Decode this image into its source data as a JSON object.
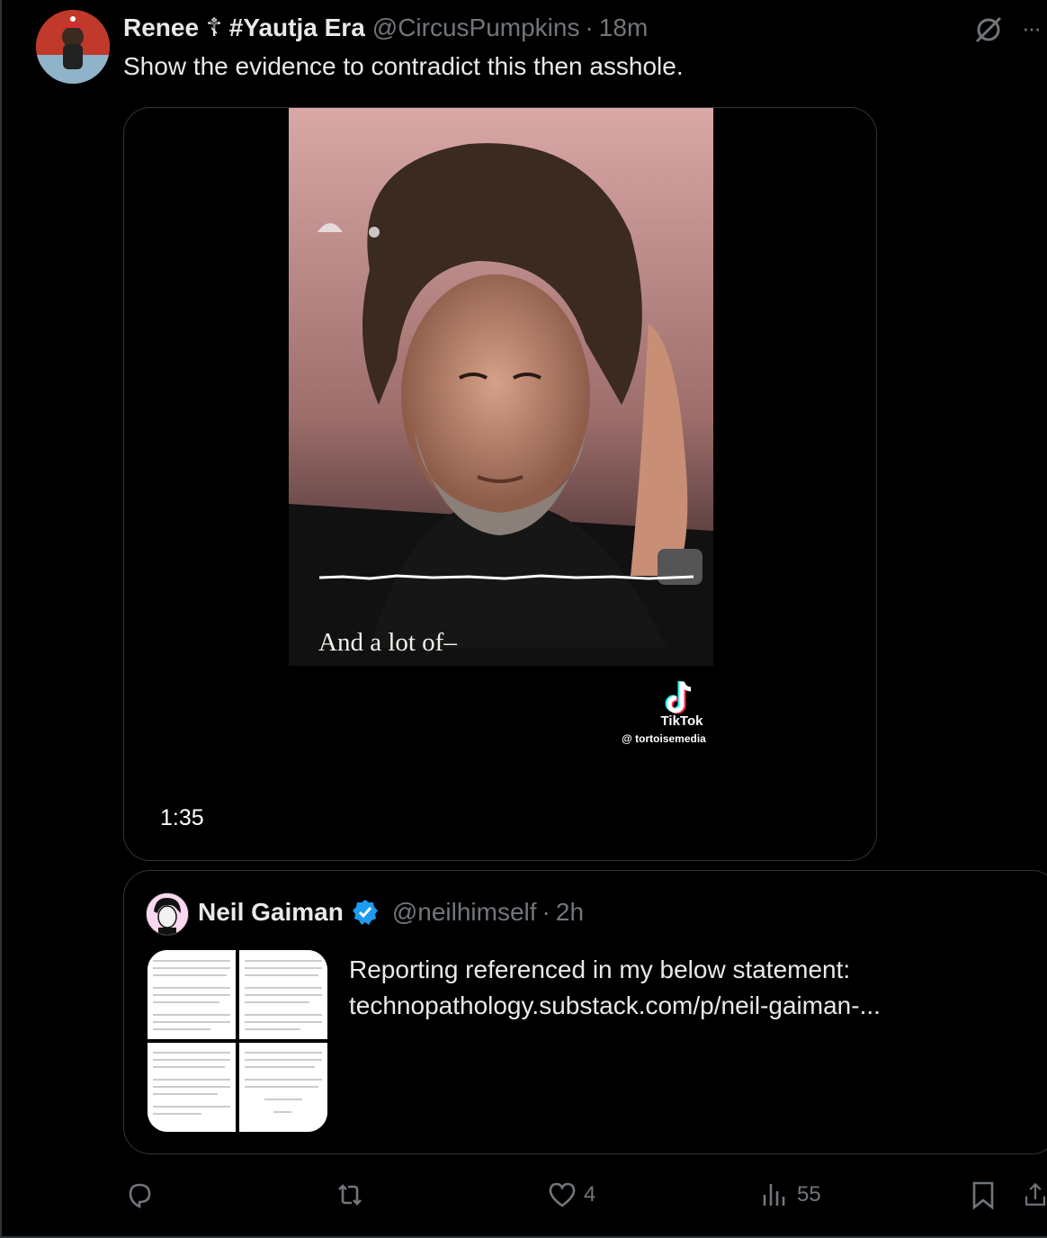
{
  "tweet": {
    "author_name": "Renee ☦ #Yautja Era",
    "handle": "@CircusPumpkins",
    "separator": "·",
    "time": "18m",
    "text": "Show the evidence to contradict this then asshole.",
    "more_label": "···"
  },
  "media": {
    "duration": "1:35",
    "caption": "And a lot of–",
    "platform": "TikTok",
    "source": "@ tortoisemedia"
  },
  "quote": {
    "author_name": "Neil Gaiman",
    "handle": "@neilhimself",
    "separator": "·",
    "time": "2h",
    "text_line1": "Reporting referenced in my below statement:",
    "text_line2": "technopathology.substack.com/p/neil-gaiman-..."
  },
  "actions": {
    "reply_count": "",
    "retweet_count": "",
    "like_count": "4",
    "views_count": "55"
  },
  "colors": {
    "background": "#000000",
    "text": "#e7e9ea",
    "muted": "#71767b",
    "border": "#2f3336",
    "verified": "#1d9bf0"
  },
  "icons": [
    "grok-icon",
    "more-icon",
    "reply-icon",
    "retweet-icon",
    "like-icon",
    "views-icon",
    "bookmark-icon",
    "share-icon",
    "verified-icon",
    "tiktok-icon"
  ]
}
